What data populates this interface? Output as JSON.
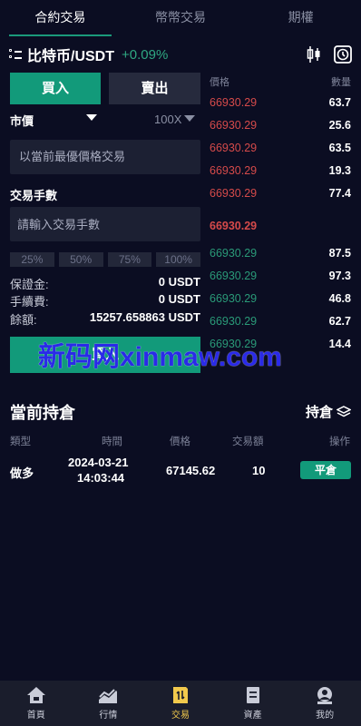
{
  "tabs": [
    "合約交易",
    "幣幣交易",
    "期權"
  ],
  "symbol": {
    "name": "比特币/USDT",
    "change": "+0.09%"
  },
  "actions": {
    "buy": "買入",
    "sell": "賣出"
  },
  "order": {
    "type": "市價",
    "leverage": "100X",
    "price_placeholder": "以當前最優價格交易",
    "qty_label": "交易手數",
    "qty_placeholder": "請輸入交易手數",
    "percents": [
      "25%",
      "50%",
      "75%",
      "100%"
    ],
    "margin_label": "保證金:",
    "margin_value": "0 USDT",
    "fee_label": "手續費:",
    "fee_value": "0 USDT",
    "balance_label": "餘額:",
    "balance_value": "15257.658863 USDT"
  },
  "orderbook": {
    "price_header": "價格",
    "qty_header": "數量",
    "asks": [
      {
        "price": "66930.29",
        "qty": "63.7"
      },
      {
        "price": "66930.29",
        "qty": "25.6"
      },
      {
        "price": "66930.29",
        "qty": "63.5"
      },
      {
        "price": "66930.29",
        "qty": "19.3"
      },
      {
        "price": "66930.29",
        "qty": "77.4"
      }
    ],
    "mid_price": "66930.29",
    "bids": [
      {
        "price": "66930.29",
        "qty": "87.5"
      },
      {
        "price": "66930.29",
        "qty": "97.3"
      },
      {
        "price": "66930.29",
        "qty": "46.8"
      },
      {
        "price": "66930.29",
        "qty": "62.7"
      },
      {
        "price": "66930.29",
        "qty": "14.4"
      }
    ]
  },
  "watermark": "新码网xinmaw.com",
  "positions": {
    "title": "當前持倉",
    "link": "持倉",
    "headers": [
      "類型",
      "時間",
      "價格",
      "交易額",
      "操作"
    ],
    "rows": [
      {
        "type": "做多",
        "date": "2024-03-21",
        "time": "14:03:44",
        "price": "67145.62",
        "amount": "10",
        "action": "平倉"
      }
    ]
  },
  "nav": [
    {
      "label": "首頁",
      "icon": "home-icon"
    },
    {
      "label": "行情",
      "icon": "chart-icon"
    },
    {
      "label": "交易",
      "icon": "trade-icon"
    },
    {
      "label": "資產",
      "icon": "wallet-icon"
    },
    {
      "label": "我的",
      "icon": "user-icon"
    }
  ],
  "colors": {
    "accent": "#129a7a",
    "ask": "#d54a4a",
    "bid": "#2a9a78",
    "nav_active": "#f2c94c"
  }
}
